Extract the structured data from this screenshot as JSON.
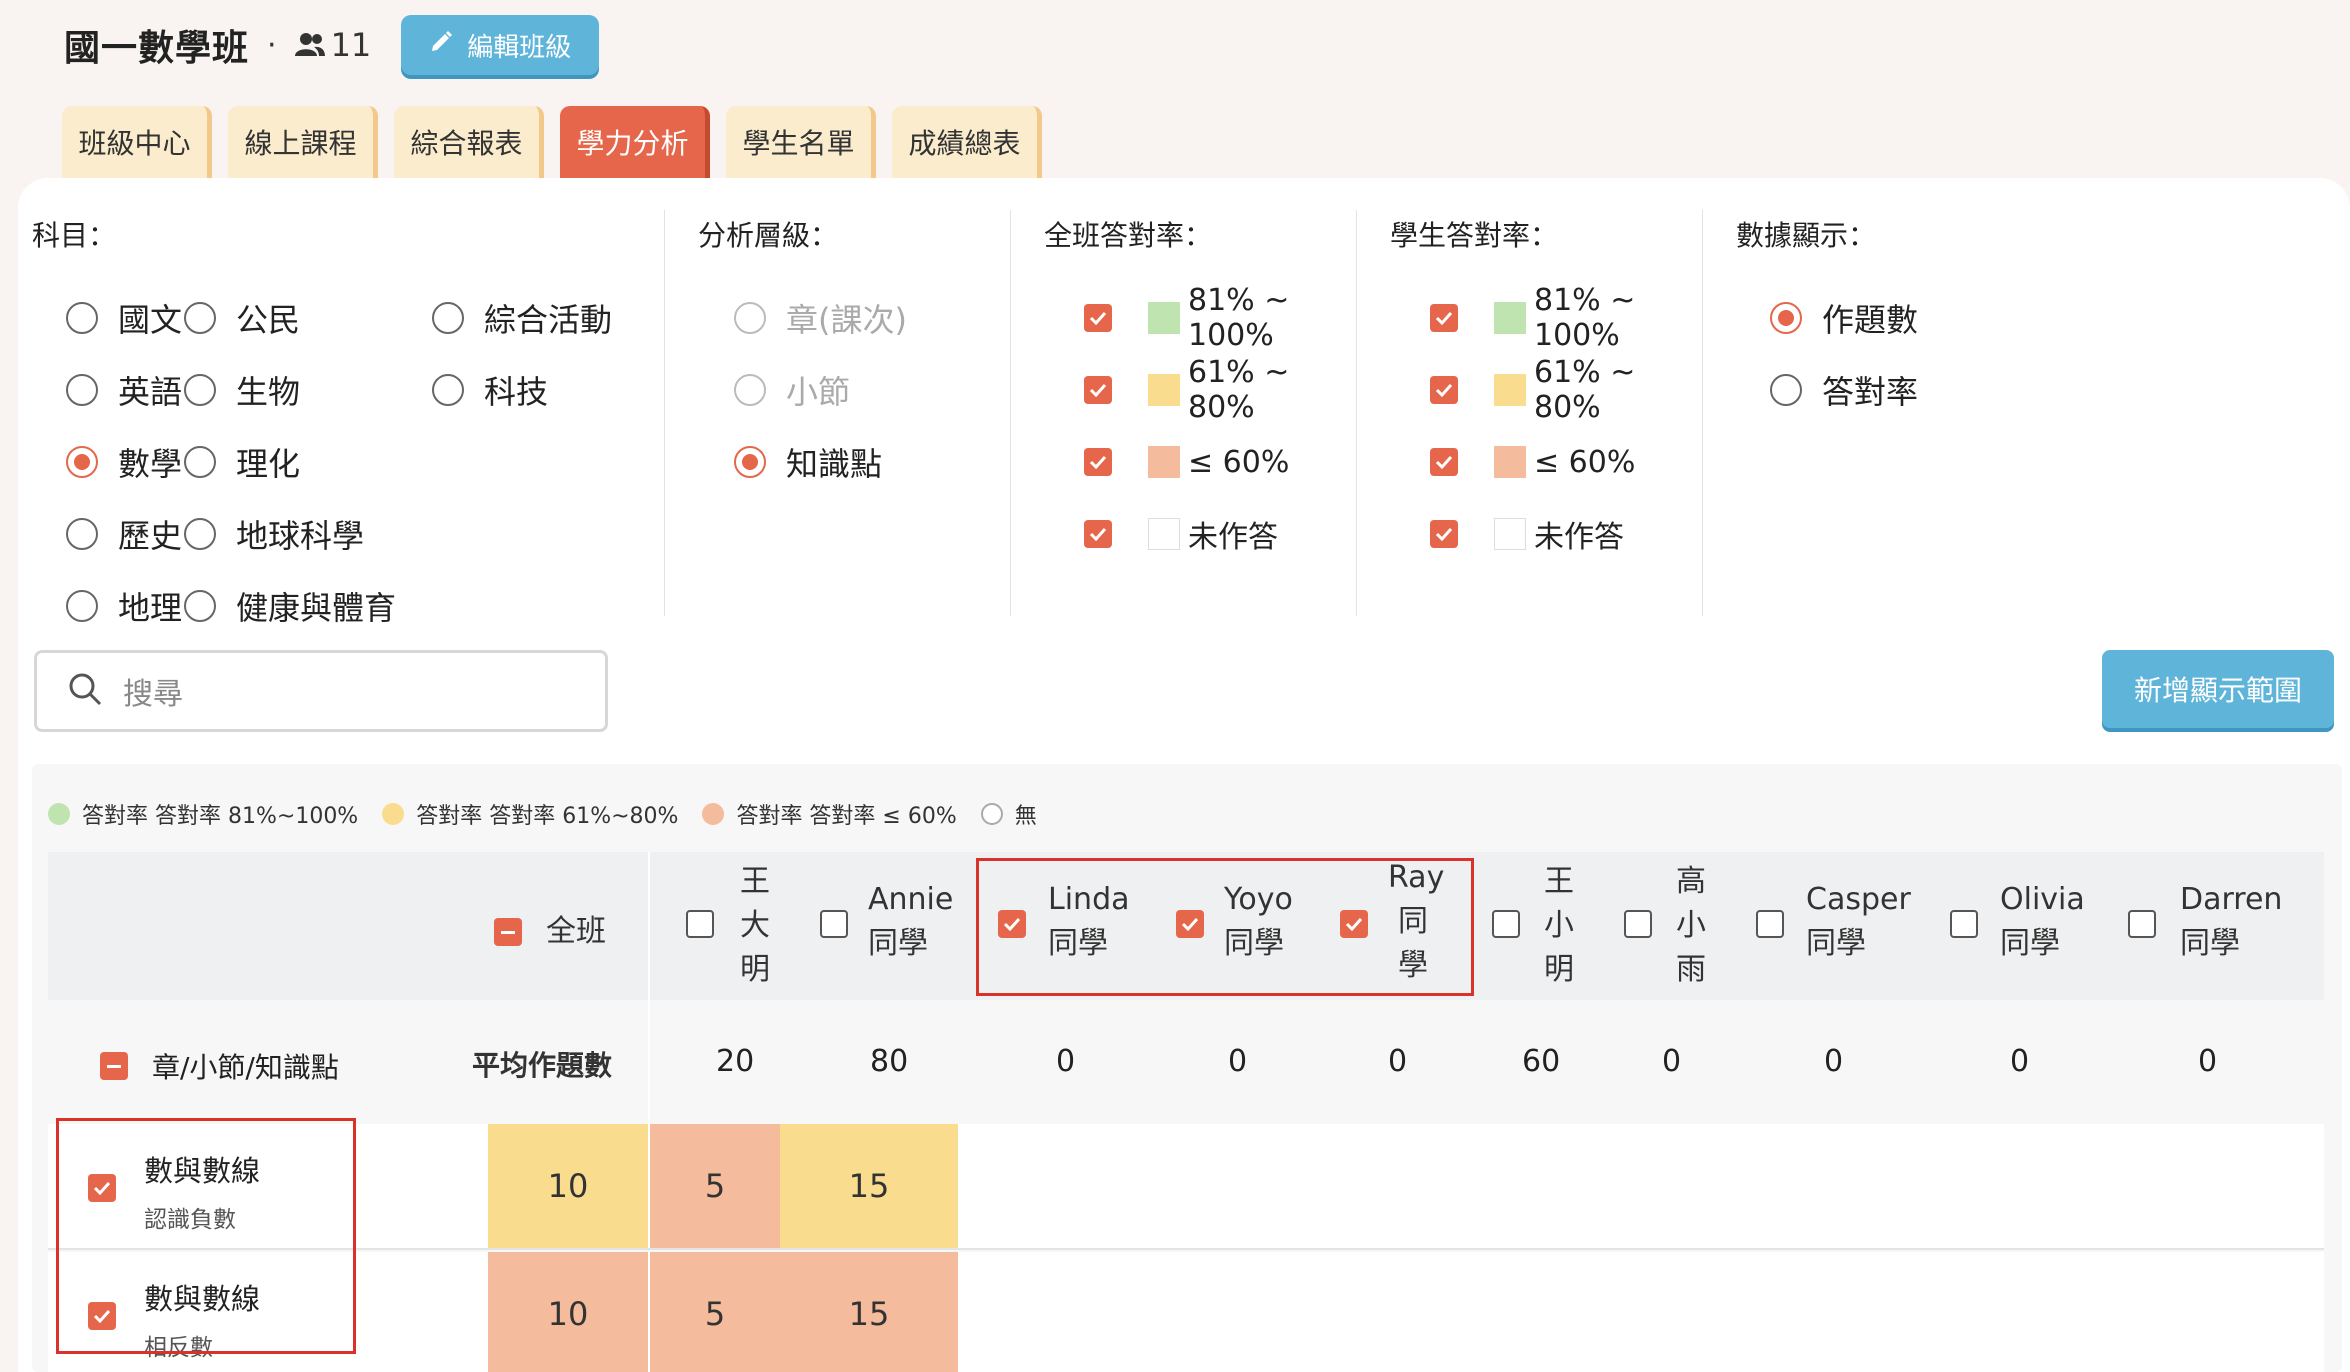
{
  "header": {
    "class_name": "國一數學班",
    "separator": "·",
    "member_count": "11",
    "edit_button": "編輯班級"
  },
  "tabs": [
    {
      "label": "班級中心",
      "active": false
    },
    {
      "label": "線上課程",
      "active": false
    },
    {
      "label": "綜合報表",
      "active": false
    },
    {
      "label": "學力分析",
      "active": true
    },
    {
      "label": "學生名單",
      "active": false
    },
    {
      "label": "成績總表",
      "active": false
    }
  ],
  "filters": {
    "subject": {
      "title": "科目：",
      "col1": [
        "國文",
        "英語",
        "數學",
        "歷史",
        "地理"
      ],
      "col2": [
        "公民",
        "生物",
        "理化",
        "地球科學",
        "健康與體育"
      ],
      "col3": [
        "綜合活動",
        "科技"
      ],
      "selected": "數學"
    },
    "level": {
      "title": "分析層級：",
      "options": [
        "章(課次)",
        "小節",
        "知識點"
      ],
      "selected": "知識點"
    },
    "class_rate": {
      "title": "全班答對率：",
      "options": [
        "81% ~ 100%",
        "61% ~ 80%",
        "≤ 60%",
        "未作答"
      ]
    },
    "student_rate": {
      "title": "學生答對率：",
      "options": [
        "81% ~ 100%",
        "61% ~ 80%",
        "≤ 60%",
        "未作答"
      ]
    },
    "display": {
      "title": "數據顯示：",
      "options": [
        "作題數",
        "答對率"
      ],
      "selected": "作題數"
    }
  },
  "colors": {
    "green": "#bfe4b0",
    "yellow": "#f9dc8e",
    "salmon": "#f4bc9c",
    "accent": "#e5664a",
    "blue": "#5fb4d9"
  },
  "search": {
    "placeholder": "搜尋"
  },
  "add_range_button": "新增顯示範圍",
  "legend": [
    {
      "label": "答對率 答對率 81%~100%",
      "color": "#bfe4b0"
    },
    {
      "label": "答對率 答對率 61%~80%",
      "color": "#f9dc8e"
    },
    {
      "label": "答對率 答對率 ≤ 60%",
      "color": "#f4bc9c"
    },
    {
      "label": "無",
      "color": "none"
    }
  ],
  "table": {
    "whole_class_label": "全班",
    "students": [
      {
        "name": "王大明",
        "checked": false
      },
      {
        "name": "Annie 同學",
        "checked": false
      },
      {
        "name": "Linda 同學",
        "checked": true
      },
      {
        "name": "Yoyo 同學",
        "checked": true
      },
      {
        "name": "Ray 同學",
        "checked": true
      },
      {
        "name": "王小明",
        "checked": false
      },
      {
        "name": "高小雨",
        "checked": false
      },
      {
        "name": "Casper 同學",
        "checked": false
      },
      {
        "name": "Olivia 同學",
        "checked": false
      },
      {
        "name": "Darren 同學",
        "checked": false
      }
    ],
    "avg_row": {
      "label": "章/小節/知識點",
      "metric": "平均作題數",
      "values": [
        "20",
        "80",
        "0",
        "0",
        "0",
        "60",
        "0",
        "0",
        "0",
        "0"
      ]
    },
    "rows": [
      {
        "title": "數與數線",
        "subtitle": "認識負數",
        "class_value": "10",
        "values": [
          "5",
          "15"
        ],
        "class_color": "yellow",
        "colors": [
          "salmon",
          "yellow"
        ]
      },
      {
        "title": "數與數線",
        "subtitle": "相反數",
        "class_value": "10",
        "values": [
          "5",
          "15"
        ],
        "class_color": "salmon",
        "colors": [
          "salmon",
          "salmon"
        ]
      }
    ]
  }
}
